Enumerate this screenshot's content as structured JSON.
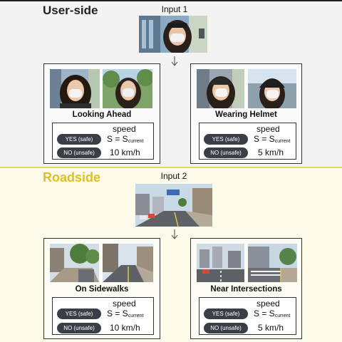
{
  "user_side": {
    "title": "User-side",
    "input_label": "Input 1",
    "panels": [
      {
        "title": "Looking Ahead",
        "speed_header": "speed",
        "yes_label": "YES (safe)",
        "no_label": "NO (unsafe)",
        "yes_value_prefix": "S = S",
        "yes_value_sub": "current",
        "no_value": "10 km/h"
      },
      {
        "title": "Wearing Helmet",
        "speed_header": "speed",
        "yes_label": "YES (safe)",
        "no_label": "NO (unsafe)",
        "yes_value_prefix": "S = S",
        "yes_value_sub": "current",
        "no_value": "5 km/h"
      }
    ]
  },
  "roadside": {
    "title": "Roadside",
    "input_label": "Input 2",
    "panels": [
      {
        "title": "On Sidewalks",
        "speed_header": "speed",
        "yes_label": "YES (safe)",
        "no_label": "NO (unsafe)",
        "yes_value_prefix": "S = S",
        "yes_value_sub": "current",
        "no_value": "10 km/h"
      },
      {
        "title": "Near Intersections",
        "speed_header": "speed",
        "yes_label": "YES (safe)",
        "no_label": "NO (unsafe)",
        "yes_value_prefix": "S = S",
        "yes_value_sub": "current",
        "no_value": "5 km/h"
      }
    ]
  },
  "colors": {
    "user_bg": "#f3f3f3",
    "road_bg": "#fcfbe9",
    "road_accent": "#e0c020",
    "pill": "#3a3f47"
  }
}
